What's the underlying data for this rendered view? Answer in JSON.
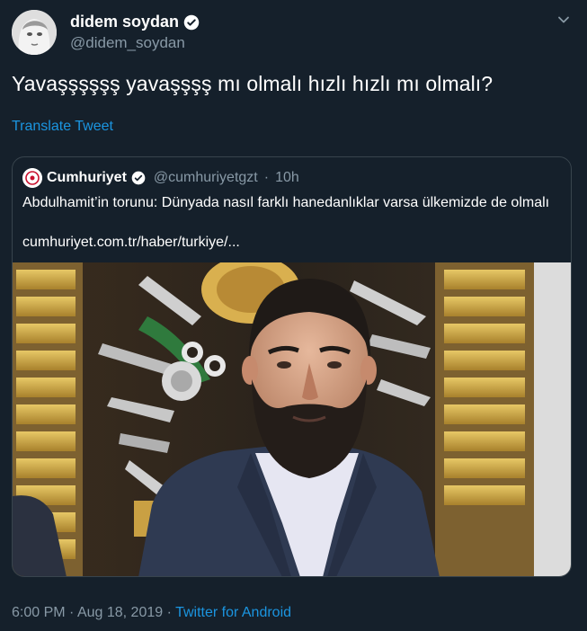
{
  "tweet": {
    "author_name": "didem soydan",
    "author_handle": "@didem_soydan",
    "text": "Yavaşşşşşş yavaşşşş mı olmalı hızlı hızlı mı olmalı?",
    "translate_label": "Translate Tweet",
    "time": "6:00 PM",
    "separator": "·",
    "date": "Aug 18, 2019",
    "source": "Twitter for Android"
  },
  "quote": {
    "author_name": "Cumhuriyet",
    "author_handle": "@cumhuriyetgzt",
    "separator": "·",
    "age": "10h",
    "text": "Abdulhamit’in torunu: Dünyada nasıl farklı hanedanlıklar varsa ülkemizde de olmalı",
    "link": "cumhuriyet.com.tr/haber/turkiye/..."
  },
  "colors": {
    "background": "#15202b",
    "secondary_text": "#8899a6",
    "link": "#1b95e0",
    "border": "#38444d"
  },
  "icons": {
    "verified": "verified-badge-icon",
    "caret": "chevron-down-icon"
  }
}
